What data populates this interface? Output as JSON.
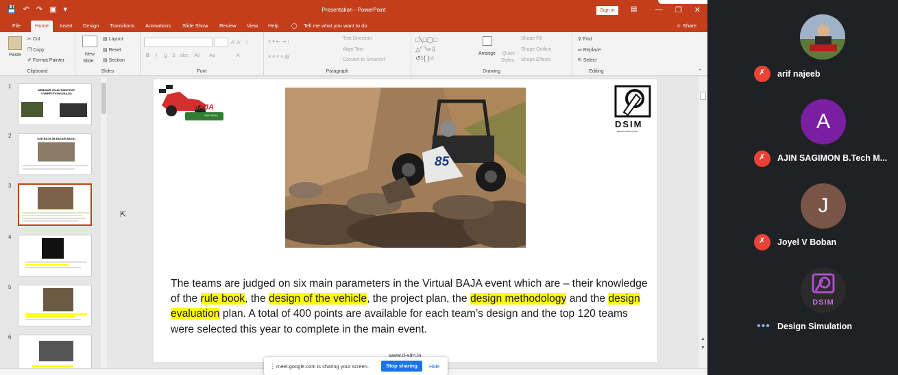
{
  "window": {
    "title": "Presentation - PowerPoint",
    "signin": "Sign in"
  },
  "tabs": [
    "File",
    "Home",
    "Insert",
    "Design",
    "Transitions",
    "Animations",
    "Slide Show",
    "Review",
    "View",
    "Help"
  ],
  "tell_me": "Tell me what you want to do",
  "share_label": "Share",
  "ribbon": {
    "clipboard": {
      "paste": "Paste",
      "cut": "Cut",
      "copy": "Copy",
      "format_painter": "Format Painter",
      "group": "Clipboard"
    },
    "slides": {
      "new_slide": "New",
      "new_slide2": "Slide",
      "layout": "Layout",
      "reset": "Reset",
      "section": "Section",
      "group": "Slides"
    },
    "font": {
      "group": "Font"
    },
    "paragraph": {
      "text_direction": "Text Direction",
      "align_text": "Align Text",
      "smartart": "Convert to SmartArt",
      "group": "Paragraph"
    },
    "drawing": {
      "arrange": "Arrange",
      "quick_styles": "Quick",
      "quick_styles2": "Styles",
      "shape_fill": "Shape Fill",
      "shape_outline": "Shape Outline",
      "shape_effects": "Shape Effects",
      "group": "Drawing"
    },
    "editing": {
      "find": "Find",
      "replace": "Replace",
      "select": "Select",
      "group": "Editing"
    }
  },
  "thumbnails": [
    {
      "num": "1",
      "title": "WEBINAR ON AUTOMOTIVE COMPETITIONS (BAJA)"
    },
    {
      "num": "2",
      "title": "SAE BAJA (M-BAJA/E-BAJA)"
    },
    {
      "num": "3",
      "title": ""
    },
    {
      "num": "4",
      "title": ""
    },
    {
      "num": "5",
      "title": ""
    },
    {
      "num": "6",
      "title": ""
    }
  ],
  "slide": {
    "logo_text": "BAJA",
    "logo_sub": "SAE INDIA",
    "dsim_logo": "DSIM",
    "dsim_tagline": "DESIGN SIMULATION",
    "car_number": "85",
    "text": {
      "p1": "The teams are judged on six main parameters in the Virtual BAJA event which are – their knowledge of the ",
      "h1": "rule book",
      "p2": ", the ",
      "h2": "design of the vehicle",
      "p3": ", the project plan, the ",
      "h3": "design methodology",
      "p4": " and the ",
      "h4": "design evaluation",
      "p5": " plan. A total of 400 points are available for each team’s design and the top 120 teams were selected this year to complete in the main event."
    },
    "footer_url": "www.d-sim.in"
  },
  "sharebar": {
    "message": "meet.google.com is sharing your screen.",
    "stop": "Stop sharing",
    "hide": "Hide"
  },
  "participants": [
    {
      "name": "arif najeeb",
      "initial": "",
      "muted": true,
      "avatar_color": "#6a7c52"
    },
    {
      "name": "AJIN SAGIMON B.Tech M...",
      "initial": "A",
      "muted": true,
      "avatar_color": "#7b1fa2"
    },
    {
      "name": "Joyel V Boban",
      "initial": "J",
      "muted": true,
      "avatar_color": "#795548"
    },
    {
      "name": "Design Simulation",
      "initial": "",
      "muted": false,
      "avatar_color": "#2b2b2b",
      "logo_text": "DSIM"
    }
  ],
  "colors": {
    "accent": "#c43e1c",
    "highlight": "#ffff00",
    "mute": "#ea4335",
    "meet_bg": "#202124",
    "stop_btn": "#1a73e8"
  }
}
